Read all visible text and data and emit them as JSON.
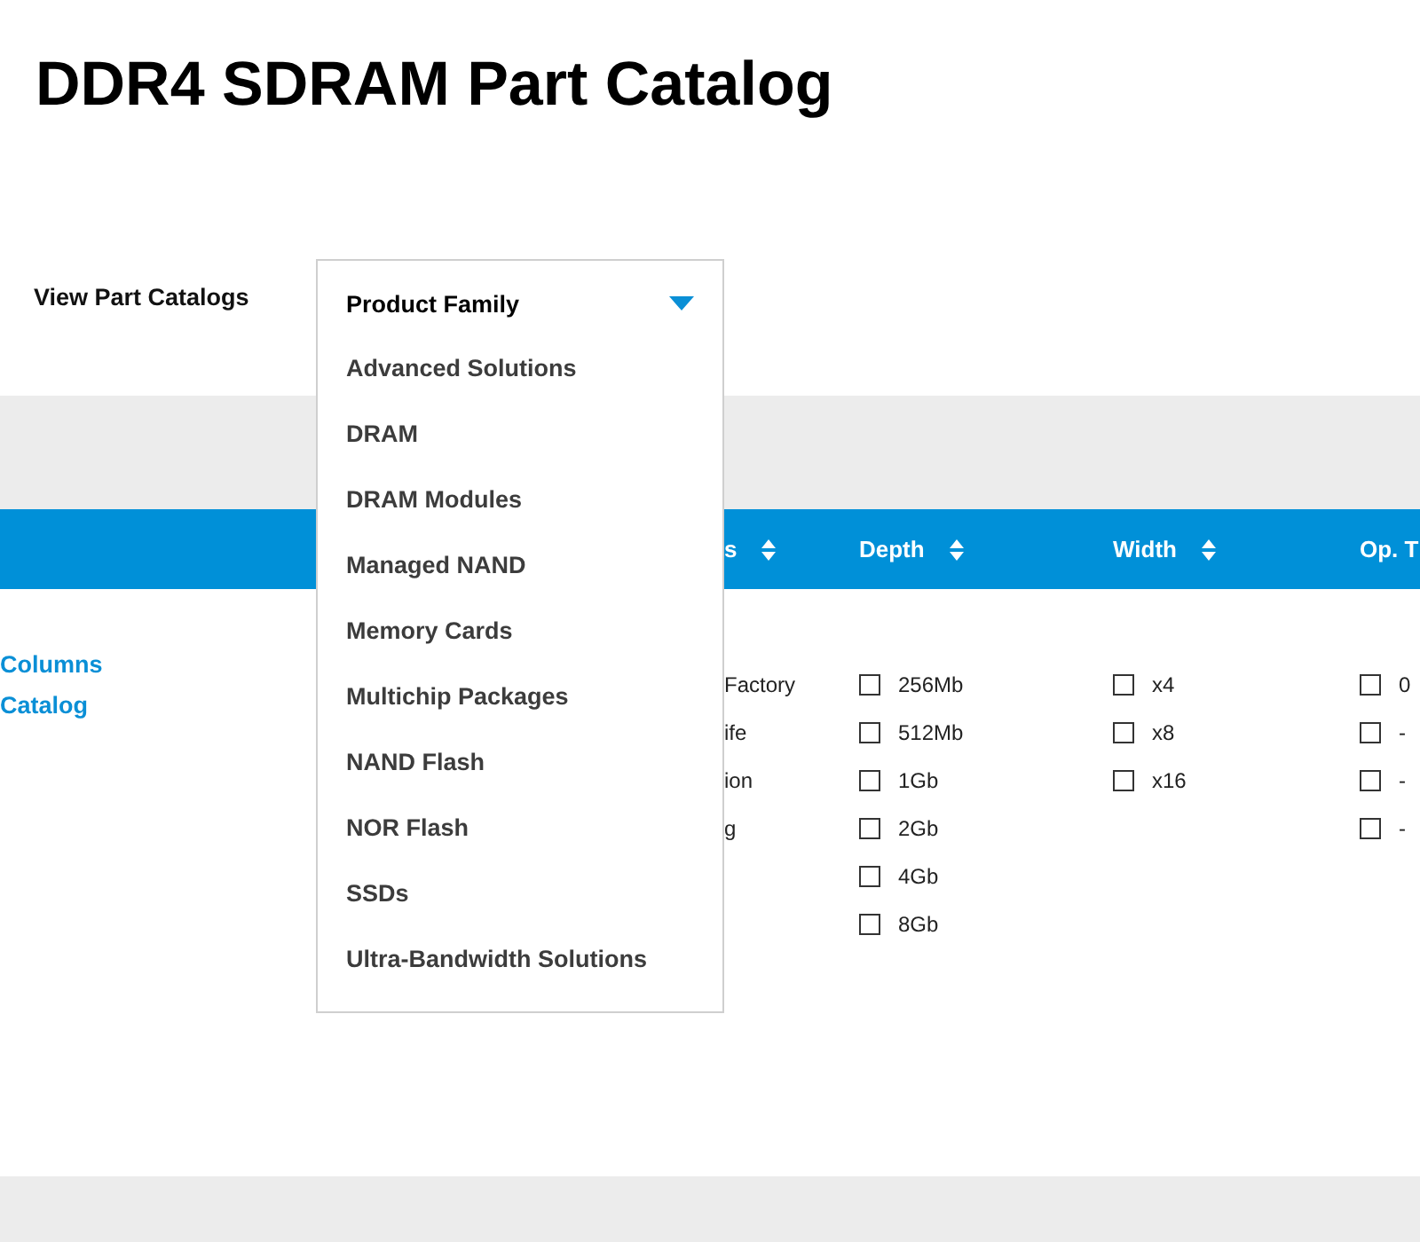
{
  "page_title": "DDR4 SDRAM Part Catalog",
  "selector": {
    "label": "View Part Catalogs",
    "dropdown": {
      "value": "Product Family",
      "expanded": true,
      "options": [
        "Advanced Solutions",
        "DRAM",
        "DRAM Modules",
        "Managed NAND",
        "Memory Cards",
        "Multichip Packages",
        "NAND Flash",
        "NOR Flash",
        "SSDs",
        "Ultra-Bandwidth Solutions"
      ]
    }
  },
  "side_links": [
    "Columns",
    "Catalog"
  ],
  "table": {
    "columns": [
      {
        "header": "s",
        "sortable": true,
        "kind": "text",
        "items": [
          {
            "label": "Factory"
          },
          {
            "label": "ife"
          },
          {
            "label": "ion"
          },
          {
            "label": "g"
          }
        ]
      },
      {
        "header": "Depth",
        "sortable": true,
        "kind": "checkbox",
        "items": [
          {
            "label": "256Mb",
            "checked": false
          },
          {
            "label": "512Mb",
            "checked": false
          },
          {
            "label": "1Gb",
            "checked": false
          },
          {
            "label": "2Gb",
            "checked": false
          },
          {
            "label": "4Gb",
            "checked": false
          },
          {
            "label": "8Gb",
            "checked": false
          }
        ]
      },
      {
        "header": "Width",
        "sortable": true,
        "kind": "checkbox",
        "items": [
          {
            "label": "x4",
            "checked": false
          },
          {
            "label": "x8",
            "checked": false
          },
          {
            "label": "x16",
            "checked": false
          }
        ]
      },
      {
        "header": "Op. T",
        "sortable": false,
        "kind": "checkbox",
        "items": [
          {
            "label": "0",
            "checked": false
          },
          {
            "label": "-",
            "checked": false
          },
          {
            "label": "-",
            "checked": false
          },
          {
            "label": "-",
            "checked": false
          }
        ]
      }
    ]
  }
}
